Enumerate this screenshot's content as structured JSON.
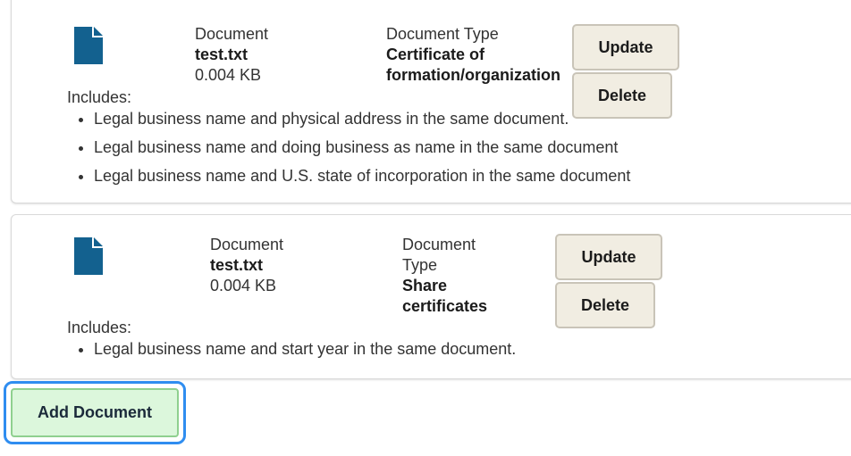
{
  "colors": {
    "file_icon": "#13618f",
    "button_bg": "#f1ede2",
    "add_button_bg": "#dcf7dc",
    "focus_ring": "#2f8df0"
  },
  "documents": [
    {
      "icon": "file-icon",
      "document_label": "Document",
      "file_name": "test.txt",
      "file_size": "0.004 KB",
      "type_label": "Document Type",
      "type_value_line1": "Certificate of",
      "type_value_line2": "formation/organization",
      "update_label": "Update",
      "delete_label": "Delete",
      "includes_label": "Includes:",
      "includes": [
        "Legal business name and physical address in the same document.",
        "Legal business name and doing business as name in the same document",
        "Legal business name and U.S. state of incorporation in the same document"
      ]
    },
    {
      "icon": "file-icon",
      "document_label": "Document",
      "file_name": "test.txt",
      "file_size": "0.004 KB",
      "type_label_line1": "Document",
      "type_label_line2": "Type",
      "type_value_line1": "Share",
      "type_value_line2": "certificates",
      "update_label": "Update",
      "delete_label": "Delete",
      "includes_label": "Includes:",
      "includes": [
        "Legal business name and start year in the same document."
      ]
    }
  ],
  "add_document_label": "Add Document"
}
